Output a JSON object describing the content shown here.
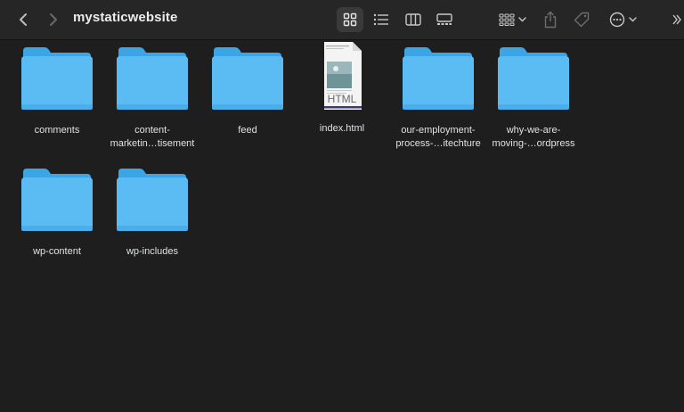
{
  "window": {
    "title": "mystaticwebsite"
  },
  "toolbar": {
    "back_icon": "chevron-left-icon",
    "forward_icon": "chevron-right-icon",
    "views": [
      "icon-view",
      "list-view",
      "column-view",
      "gallery-view"
    ],
    "active_view": "icon-view",
    "group_icon": "group-grid-icon",
    "share_icon": "share-icon",
    "tag_icon": "tag-icon",
    "more_icon": "ellipsis-circle-icon"
  },
  "colors": {
    "folder_front": "#5bbcf3",
    "folder_back": "#3ba5e6",
    "background": "#1e1e1e",
    "toolbar": "#262626"
  },
  "files": [
    {
      "name": "comments",
      "label": "comments",
      "kind": "folder"
    },
    {
      "name": "content-marketing",
      "label": "content-\nmarketin…tisement",
      "kind": "folder"
    },
    {
      "name": "feed",
      "label": "feed",
      "kind": "folder"
    },
    {
      "name": "index-html",
      "label": "index.html",
      "kind": "html",
      "badge": "HTML"
    },
    {
      "name": "our-employment-process",
      "label": "our-employment-\nprocess-…itechture",
      "kind": "folder"
    },
    {
      "name": "why-we-are-moving",
      "label": "why-we-are-\nmoving-…ordpress",
      "kind": "folder"
    },
    {
      "name": "wp-content",
      "label": "wp-content",
      "kind": "folder"
    },
    {
      "name": "wp-includes",
      "label": "wp-includes",
      "kind": "folder"
    }
  ]
}
